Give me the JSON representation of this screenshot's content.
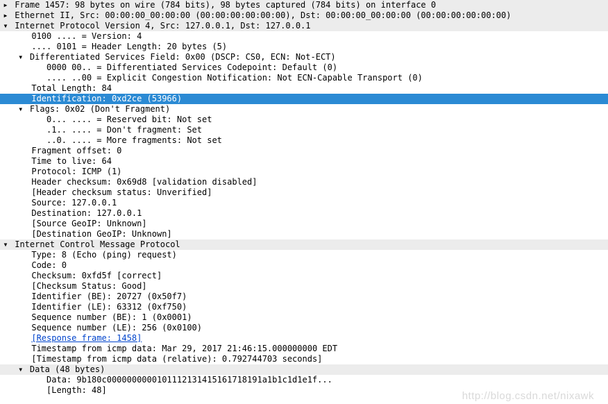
{
  "frame": "Frame 1457: 98 bytes on wire (784 bits), 98 bytes captured (784 bits) on interface 0",
  "eth": "Ethernet II, Src: 00:00:00_00:00:00 (00:00:00:00:00:00), Dst: 00:00:00_00:00:00 (00:00:00:00:00:00)",
  "ip": {
    "title": "Internet Protocol Version 4, Src: 127.0.0.1, Dst: 127.0.0.1",
    "version": "0100 .... = Version: 4",
    "hlen": ".... 0101 = Header Length: 20 bytes (5)",
    "dsf": "Differentiated Services Field: 0x00 (DSCP: CS0, ECN: Not-ECT)",
    "dsf_dscp": "0000 00.. = Differentiated Services Codepoint: Default (0)",
    "dsf_ecn": ".... ..00 = Explicit Congestion Notification: Not ECN-Capable Transport (0)",
    "tlen": "Total Length: 84",
    "ident": "Identification: 0xd2ce (53966)",
    "flags": "Flags: 0x02 (Don't Fragment)",
    "flag_r": "0... .... = Reserved bit: Not set",
    "flag_df": ".1.. .... = Don't fragment: Set",
    "flag_mf": "..0. .... = More fragments: Not set",
    "fragoff": "Fragment offset: 0",
    "ttl": "Time to live: 64",
    "proto": "Protocol: ICMP (1)",
    "hcksum": "Header checksum: 0x69d8 [validation disabled]",
    "hcksum_st": "[Header checksum status: Unverified]",
    "src": "Source: 127.0.0.1",
    "dst": "Destination: 127.0.0.1",
    "geo_src": "[Source GeoIP: Unknown]",
    "geo_dst": "[Destination GeoIP: Unknown]"
  },
  "icmp": {
    "title": "Internet Control Message Protocol",
    "type": "Type: 8 (Echo (ping) request)",
    "code": "Code: 0",
    "cksum": "Checksum: 0xfd5f [correct]",
    "cksum_st": "[Checksum Status: Good]",
    "id_be": "Identifier (BE): 20727 (0x50f7)",
    "id_le": "Identifier (LE): 63312 (0xf750)",
    "seq_be": "Sequence number (BE): 1 (0x0001)",
    "seq_le": "Sequence number (LE): 256 (0x0100)",
    "resp": "[Response frame: 1458]",
    "ts": "Timestamp from icmp data: Mar 29, 2017 21:46:15.000000000 EDT",
    "ts_rel": "[Timestamp from icmp data (relative): 0.792744703 seconds]",
    "data_title": "Data (48 bytes)",
    "data_hex": "Data: 9b180c0000000000101112131415161718191a1b1c1d1e1f...",
    "data_len": "[Length: 48]"
  },
  "watermark": "http://blog.csdn.net/nixawk"
}
